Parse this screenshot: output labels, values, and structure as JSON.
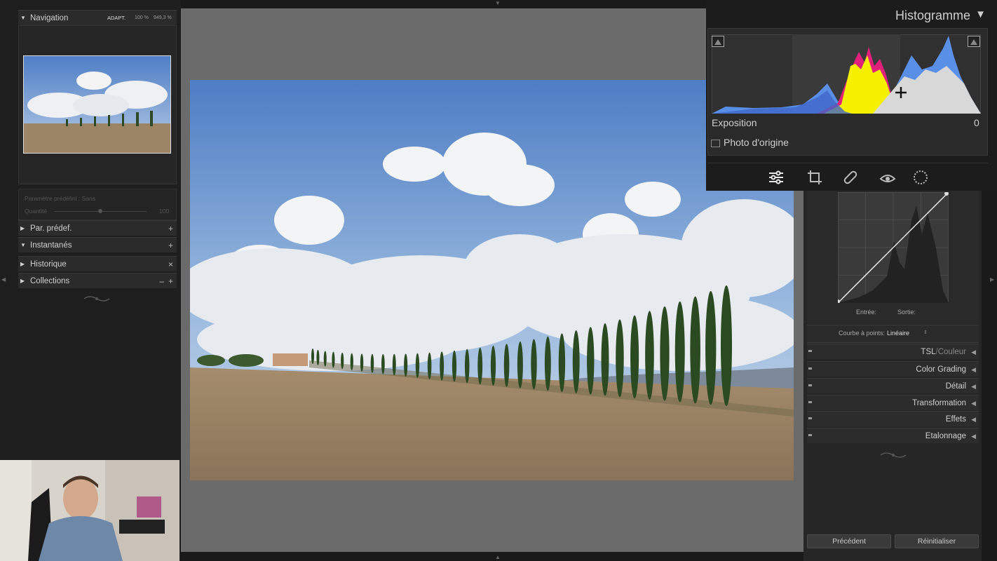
{
  "navigator": {
    "title": "Navigation",
    "zoom_options": [
      "ADAPT.",
      "100 %",
      "949,3 %"
    ]
  },
  "quick_preset": {
    "label": "Paramètre prédéfini : Sans",
    "amount_label": "Quantité",
    "amount_value": "100"
  },
  "left_panels": [
    {
      "label": "Par. prédef.",
      "expanded": false,
      "action": "+"
    },
    {
      "label": "Instantanés",
      "expanded": true,
      "action": "+"
    },
    {
      "label": "Historique",
      "expanded": false,
      "action": "×"
    },
    {
      "label": "Collections",
      "expanded": false,
      "action": "+",
      "action2": "–"
    }
  ],
  "histogram": {
    "title": "Histogramme",
    "exposure_label": "Exposition",
    "exposure_value": "0",
    "original_photo_label": "Photo d'origine"
  },
  "tools": [
    "sliders-icon",
    "crop-icon",
    "healing-icon",
    "redeye-icon",
    "masking-icon"
  ],
  "tone_curve": {
    "input_label": "Entrée:",
    "output_label": "Sortie:",
    "point_curve_label": "Courbe à points:",
    "point_curve_value": "Linéaire"
  },
  "right_panels": [
    {
      "label": "TSL",
      "label_suffix": "Couleur"
    },
    {
      "label": "Color Grading"
    },
    {
      "label": "Détail"
    },
    {
      "label": "Transformation"
    },
    {
      "label": "Effets"
    },
    {
      "label": "Etalonnage"
    }
  ],
  "buttons": {
    "previous": "Précédent",
    "reset": "Réinitialiser"
  },
  "colors": {
    "accent_yellow": "#f5f000",
    "accent_blue": "#5a8fe8",
    "accent_magenta": "#e0207a"
  }
}
